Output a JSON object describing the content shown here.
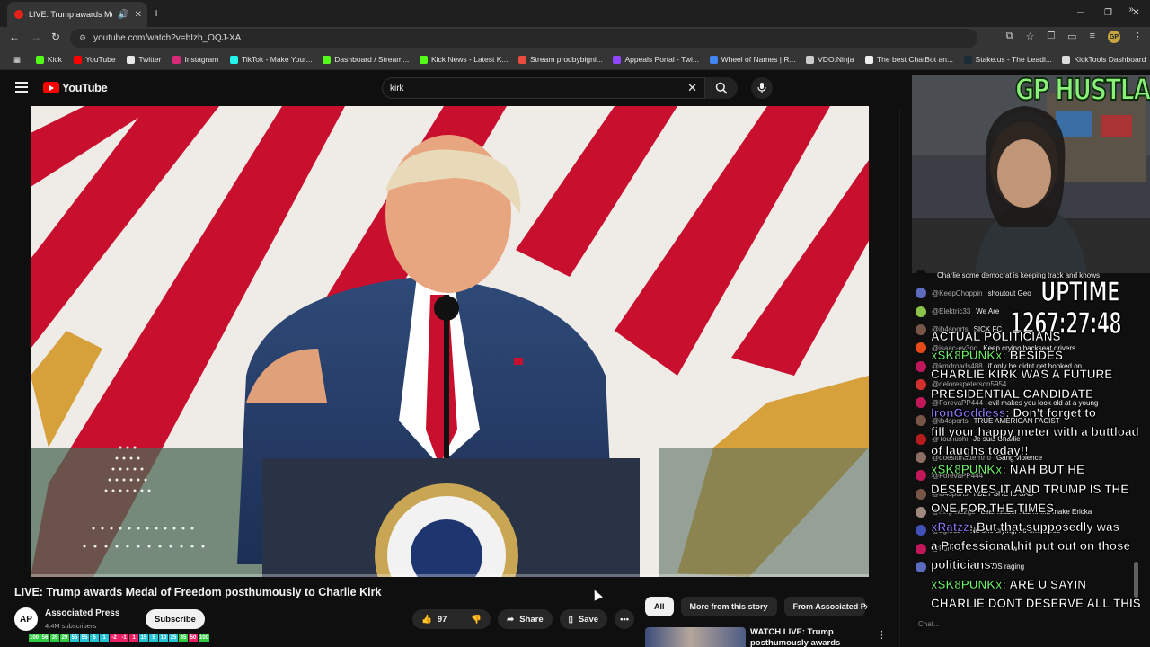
{
  "browser": {
    "tab_title": "LIVE: Trump awards Medal",
    "url": "youtube.com/watch?v=bIzb_OQJ-XA",
    "bookmarks": [
      {
        "label": "Kick",
        "color": "#53fc18"
      },
      {
        "label": "YouTube",
        "color": "#ff0000"
      },
      {
        "label": "Twitter",
        "color": "#e7e7e7"
      },
      {
        "label": "Instagram",
        "color": "#d62976"
      },
      {
        "label": "TikTok - Make Your...",
        "color": "#25f4ee"
      },
      {
        "label": "Dashboard / Stream...",
        "color": "#53fc18"
      },
      {
        "label": "Kick News - Latest K...",
        "color": "#53fc18"
      },
      {
        "label": "Stream prodbybigni...",
        "color": "#e74c3c"
      },
      {
        "label": "Appeals Portal - Twi...",
        "color": "#9146ff"
      },
      {
        "label": "Wheel of Names | R...",
        "color": "#4285f4"
      },
      {
        "label": "VDO.Ninja",
        "color": "#cccccc"
      },
      {
        "label": "The best ChatBot an...",
        "color": "#eeeeee"
      },
      {
        "label": "Stake.us - The Leadi...",
        "color": "#1a2c38"
      },
      {
        "label": "KickTools Dashboard",
        "color": "#dddddd"
      }
    ]
  },
  "youtube": {
    "logo_text": "YouTube",
    "search_value": "kirk",
    "video": {
      "title": "LIVE: Trump awards Medal of Freedom posthumously to Charlie Kirk",
      "progress_fraction": 0.0
    },
    "channel": {
      "avatar_text": "AP",
      "name": "Associated Press",
      "subs": "4.4M subscribers",
      "subscribe_label": "Subscribe"
    },
    "actions": {
      "like_count": "97",
      "share_label": "Share",
      "save_label": "Save"
    },
    "chips": [
      "All",
      "More from this story",
      "From Associated Pr"
    ],
    "recommended": {
      "title": "WATCH LIVE: Trump posthumously awards Charlie"
    }
  },
  "overlay": {
    "brand": "GP HUSTLA",
    "uptime_label": "UPTIME",
    "uptime_value": "1267:27:48",
    "level_values": [
      "100",
      "56",
      "35",
      "29",
      "55",
      "55",
      "5",
      "1",
      "-2",
      "-1",
      "1",
      "15",
      "5",
      "10",
      "25",
      "35",
      "50",
      "100"
    ],
    "level_colors": [
      "#2ecc40",
      "#2ecc40",
      "#2ecc40",
      "#2ecc40",
      "#23c3d6",
      "#23c3d6",
      "#23c3d6",
      "#23c3d6",
      "#e91e63",
      "#e91e63",
      "#e91e63",
      "#23c3d6",
      "#23c3d6",
      "#23c3d6",
      "#23c3d6",
      "#2ecc40",
      "#e91e63",
      "#2ecc40"
    ],
    "yt_chat": [
      {
        "user": "",
        "msg": "Charlie some democrat is keeping track and knows",
        "color": "#0f0f0f"
      },
      {
        "user": "@KeepChoppin",
        "msg": "shoutout Geo",
        "color": "#5c6bc0"
      },
      {
        "user": "@Elektric33",
        "msg": "We Are",
        "color": "#8bc34a"
      },
      {
        "user": "@ib4sports",
        "msg": "SICK FC",
        "color": "#795548"
      },
      {
        "user": "@isaac-ev3nq",
        "msg": "Keep crying backseat drivers",
        "color": "#e64a19"
      },
      {
        "user": "@kmdroads488",
        "msg": "if only he didnt get hooked on",
        "color": "#c2185b"
      },
      {
        "user": "@delorespeterson5954",
        "msg": "",
        "color": "#d32f2f"
      },
      {
        "user": "@ForevaPP444",
        "msg": "evil makes you look old at a young",
        "color": "#c2185b"
      },
      {
        "user": "@ib4sports",
        "msg": "TRUE AMERICAN FACIST",
        "color": "#795548"
      },
      {
        "user": "@Tounushi",
        "msg": "Je suis Charlie",
        "color": "#b71c1c"
      },
      {
        "user": "@doesitmatterrtho",
        "msg": "Gang violence",
        "color": "#8d6e63"
      },
      {
        "user": "@ForevaPP444",
        "msg": "",
        "color": "#c2185b"
      },
      {
        "user": "@ib4sports",
        "msg": "I BET SHE IS SAD",
        "color": "#795548"
      },
      {
        "user": "@king-wz2gb",
        "msg": "dear leader has ninna make Ericka",
        "color": "#a1887f"
      },
      {
        "user": "@Lg.3124",
        "msg": "No one crying, no one cares",
        "color": "#3f51b5"
      },
      {
        "user": "@ForevaPP444",
        "msg": "eeeeeew",
        "color": "#c2185b"
      },
      {
        "user": "@KeepChoppin",
        "msg": "TDS raging",
        "color": "#5c6bc0"
      }
    ],
    "kick_chat": [
      {
        "text": "ACTUAL POLITICIANS"
      },
      {
        "user": "xSK8PUNKx",
        "text": ": BESIDES"
      },
      {
        "text": "CHARLIE KIRK WAS A FUTURE"
      },
      {
        "text": "PRESIDENTIAL CANDIDATE"
      },
      {
        "user": "IronGoddess",
        "text": ": Don't forget to"
      },
      {
        "text": "fill your happy meter with a buttload"
      },
      {
        "text": "of laughs today!!"
      },
      {
        "user": "xSK8PUNKx",
        "text": ": NAH BUT HE"
      },
      {
        "text": "DESERVES IT AND TRUMP IS THE"
      },
      {
        "text": "ONE FOR THE TIMES"
      },
      {
        "user": "xRatzz",
        "text": ": But that supposedly was"
      },
      {
        "text": "a Professional hit put out on those"
      },
      {
        "text": "politicians."
      },
      {
        "user": "xSK8PUNKx",
        "text": ": ARE U SAYIN"
      },
      {
        "text": "CHARLIE DONT DESERVE ALL THIS"
      }
    ],
    "chat_input_placeholder": "Chat..."
  }
}
